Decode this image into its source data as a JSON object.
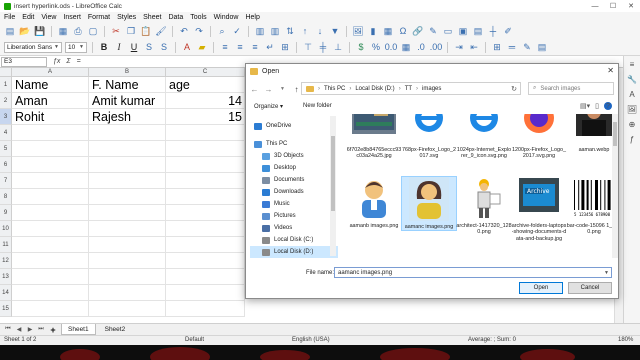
{
  "window": {
    "title": "insert hyperlink.ods - LibreOffice Calc",
    "controls": [
      "—",
      "☐",
      "✕"
    ]
  },
  "menubar": [
    "File",
    "Edit",
    "View",
    "Insert",
    "Format",
    "Styles",
    "Sheet",
    "Data",
    "Tools",
    "Window",
    "Help"
  ],
  "toolbar": {
    "font_name": "Liberation Sans",
    "font_size": "10"
  },
  "formula_bar": {
    "cell_ref": "E3",
    "fx": "ƒx",
    "value": ""
  },
  "sheet": {
    "columns": [
      "A",
      "B",
      "C"
    ],
    "rows": [
      "1",
      "2",
      "3",
      "4",
      "5",
      "6",
      "7",
      "8",
      "9",
      "10",
      "11",
      "12",
      "13",
      "14",
      "15"
    ],
    "cells": [
      [
        "Name",
        "F. Name",
        "age"
      ],
      [
        "Aman",
        "Amit kumar",
        "14"
      ],
      [
        "Rohit",
        "Rajesh",
        "15"
      ]
    ]
  },
  "tabs": {
    "sheets": [
      "Sheet1",
      "Sheet2"
    ],
    "active": "Sheet1"
  },
  "status": {
    "sheet_info": "Sheet 1 of 2",
    "page_style": "Default",
    "language": "English (USA)",
    "summary": "Average: ; Sum: 0",
    "zoom": "180%"
  },
  "dialog": {
    "title": "Open",
    "close": "✕",
    "path": [
      "This PC",
      "Local Disk (D:)",
      "TT",
      "images"
    ],
    "search_placeholder": "Search images",
    "organize": "Organize ▾",
    "new_folder": "New folder",
    "nav_items": [
      {
        "label": "OneDrive",
        "icon": "onedrive-icon",
        "color": "#2b7cd3"
      },
      {
        "label": "This PC",
        "icon": "computer-icon",
        "color": "#4a90d9"
      },
      {
        "label": "3D Objects",
        "icon": "cube-icon",
        "color": "#5aa0e0"
      },
      {
        "label": "Desktop",
        "icon": "desktop-icon",
        "color": "#3d8fd9"
      },
      {
        "label": "Documents",
        "icon": "documents-icon",
        "color": "#7d8ea3"
      },
      {
        "label": "Downloads",
        "icon": "download-icon",
        "color": "#2b7cd3"
      },
      {
        "label": "Music",
        "icon": "music-icon",
        "color": "#3a7bd5"
      },
      {
        "label": "Pictures",
        "icon": "pictures-icon",
        "color": "#5b8fd0"
      },
      {
        "label": "Videos",
        "icon": "videos-icon",
        "color": "#4a6fa5"
      },
      {
        "label": "Local Disk (C:)",
        "icon": "drive-icon",
        "color": "#8a8a8a"
      },
      {
        "label": "Local Disk (D:)",
        "icon": "drive-icon",
        "color": "#8a8a8a"
      }
    ],
    "selected_nav": "Local Disk (D:)",
    "files_row1": [
      {
        "name": "6f702e8b84765eccc93c03a24a25.jpg",
        "kind": "factory"
      },
      {
        "name": "768px-Firefox_Logo_2017.svg",
        "kind": "ie"
      },
      {
        "name": "1024px-Internet_Explorer_9_icon.svg.png",
        "kind": "ie"
      },
      {
        "name": "1200px-Firefox_Logo_2017.svg.png",
        "kind": "firefox"
      },
      {
        "name": "aaman.webp",
        "kind": "person-dark"
      }
    ],
    "files_row2": [
      {
        "name": "aamanb images.png",
        "kind": "avatar-blue"
      },
      {
        "name": "aamanc images.png",
        "kind": "avatar-woman"
      },
      {
        "name": "architect-1417320_1280.png",
        "kind": "architect"
      },
      {
        "name": "archive-folders-laptops-showing-documents-data-and-backup.jpg",
        "kind": "archive"
      },
      {
        "name": "bar-code-15096 1_1280.png",
        "kind": "barcode"
      }
    ],
    "selected_file": "aamanc images.png",
    "filename_label": "File name:",
    "filename_value": "aamanc images.png",
    "open_label": "Open",
    "cancel_label": "Cancel",
    "barcode_number": "5 123456 678900",
    "archive_label": "Archive"
  },
  "colors": {
    "accent": "#0078d7",
    "selection": "#cce8ff",
    "calc_green": "#18a303"
  }
}
